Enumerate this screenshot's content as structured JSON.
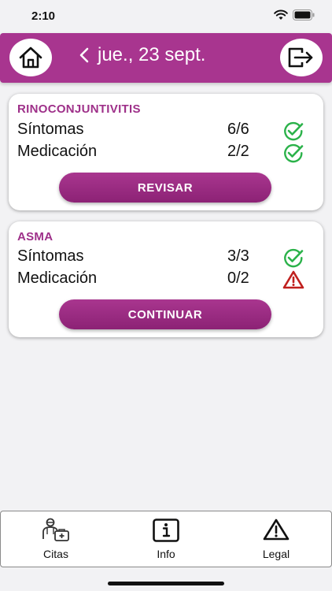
{
  "status_bar": {
    "time": "2:10"
  },
  "header": {
    "date": "jue., 23 sept."
  },
  "cards": [
    {
      "title": "RINOCONJUNTIVITIS",
      "rows": [
        {
          "label": "Síntomas",
          "count": "6/6",
          "status": "check-circle-icon"
        },
        {
          "label": "Medicación",
          "count": "2/2",
          "status": "check-circle-icon"
        }
      ],
      "button": "REVISAR"
    },
    {
      "title": "ASMA",
      "rows": [
        {
          "label": "Síntomas",
          "count": "3/3",
          "status": "check-circle-icon"
        },
        {
          "label": "Medicación",
          "count": "0/2",
          "status": "warning-icon"
        }
      ],
      "button": "CONTINUAR"
    }
  ],
  "tabbar": {
    "items": [
      {
        "label": "Citas",
        "icon": "doctor-appointment-icon"
      },
      {
        "label": "Info",
        "icon": "info-icon"
      },
      {
        "label": "Legal",
        "icon": "warning-icon"
      }
    ]
  },
  "colors": {
    "brand": "#a8358f",
    "check": "#2bb24a",
    "warning": "#c0201e"
  }
}
